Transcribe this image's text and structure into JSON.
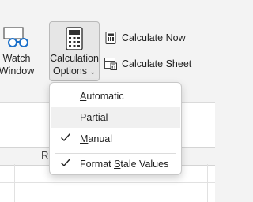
{
  "ribbon": {
    "watch_window": {
      "line1": "Watch",
      "line2": "Window",
      "icon": "glasses-icon"
    },
    "calculation_options": {
      "line1": "Calculation",
      "line2": "Options",
      "icon": "calculator-icon",
      "chevron": "⌄"
    },
    "calculate_now": {
      "label": "Calculate Now",
      "icon": "calculator-small-icon"
    },
    "calculate_sheet": {
      "label": "Calculate Sheet",
      "icon": "calculate-sheet-icon"
    }
  },
  "menu": {
    "items": [
      {
        "accel": "A",
        "rest": "utomatic",
        "checked": false
      },
      {
        "accel": "P",
        "rest": "artial",
        "checked": false
      },
      {
        "accel": "M",
        "rest": "anual",
        "checked": true
      },
      {
        "pre": "Format ",
        "accel": "S",
        "rest": "tale Values",
        "checked": true
      }
    ]
  },
  "sheet": {
    "column_header": "R"
  }
}
